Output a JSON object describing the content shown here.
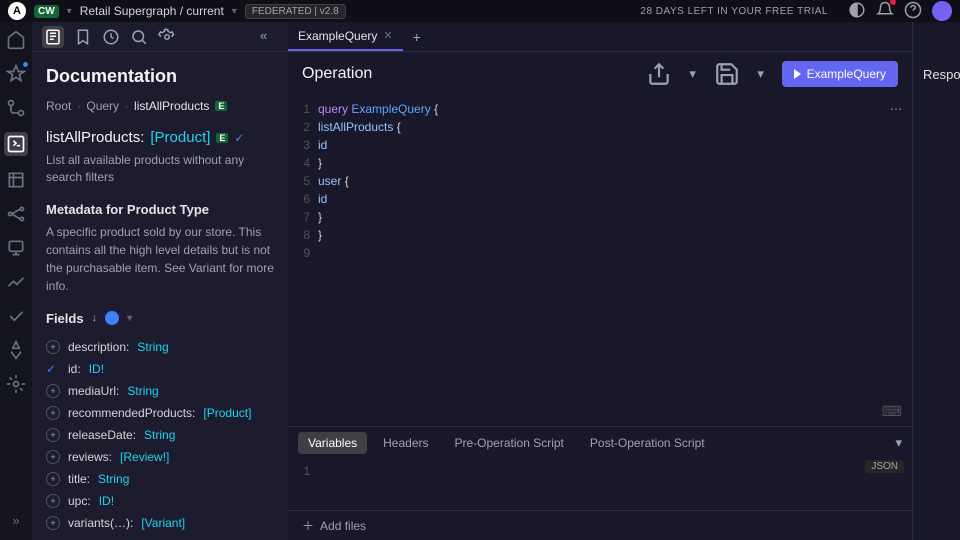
{
  "topbar": {
    "logo_letter": "A",
    "org_badge": "CW",
    "org_name": "Retail Supergraph / current",
    "federation_badge": "FEDERATED | v2.8",
    "trial_text": "28 DAYS LEFT IN YOUR FREE TRIAL"
  },
  "doc": {
    "title": "Documentation",
    "breadcrumb": [
      "Root",
      "Query",
      "listAllProducts"
    ],
    "entity_heading_name": "listAllProducts:",
    "entity_heading_type": "[Product]",
    "description": "List all available products without any search filters",
    "metadata_title": "Metadata for Product Type",
    "metadata_text": "A specific product sold by our store. This contains all the high level details but is not the purchasable item. See Variant for more info.",
    "fields_label": "Fields",
    "fields": [
      {
        "name": "description:",
        "type": "String",
        "checked": false
      },
      {
        "name": "id:",
        "type": "ID!",
        "checked": true
      },
      {
        "name": "mediaUrl:",
        "type": "String",
        "checked": false
      },
      {
        "name": "recommendedProducts:",
        "type": "[Product]",
        "checked": false
      },
      {
        "name": "releaseDate:",
        "type": "String",
        "checked": false
      },
      {
        "name": "reviews:",
        "type": "[Review!]",
        "checked": false
      },
      {
        "name": "title:",
        "type": "String",
        "checked": false
      },
      {
        "name": "upc:",
        "type": "ID!",
        "checked": false
      },
      {
        "name": "variants(…):",
        "type": "[Variant]",
        "checked": false
      }
    ]
  },
  "operation": {
    "tab_name": "ExampleQuery",
    "header": "Operation",
    "run_label": "ExampleQuery",
    "code_lines": [
      {
        "n": 1,
        "tokens": [
          {
            "t": "query ",
            "c": "kw"
          },
          {
            "t": "ExampleQuery ",
            "c": "ident"
          },
          {
            "t": "{",
            "c": "brace"
          }
        ]
      },
      {
        "n": 2,
        "tokens": [
          {
            "t": "  ",
            "c": ""
          },
          {
            "t": "listAllProducts ",
            "c": "field-tok"
          },
          {
            "t": "{",
            "c": "brace"
          }
        ]
      },
      {
        "n": 3,
        "tokens": [
          {
            "t": "    ",
            "c": ""
          },
          {
            "t": "id",
            "c": "field-tok"
          }
        ]
      },
      {
        "n": 4,
        "tokens": [
          {
            "t": "  ",
            "c": ""
          },
          {
            "t": "}",
            "c": "brace"
          }
        ]
      },
      {
        "n": 5,
        "tokens": [
          {
            "t": "  ",
            "c": ""
          },
          {
            "t": "user ",
            "c": "field-tok"
          },
          {
            "t": "{",
            "c": "brace"
          }
        ]
      },
      {
        "n": 6,
        "tokens": [
          {
            "t": "    ",
            "c": ""
          },
          {
            "t": "id",
            "c": "field-tok"
          }
        ]
      },
      {
        "n": 7,
        "tokens": [
          {
            "t": "  ",
            "c": ""
          },
          {
            "t": "}",
            "c": "brace"
          }
        ]
      },
      {
        "n": 8,
        "tokens": [
          {
            "t": "}",
            "c": "brace"
          }
        ]
      },
      {
        "n": 9,
        "tokens": []
      }
    ],
    "bottom_tabs": [
      "Variables",
      "Headers",
      "Pre-Operation Script",
      "Post-Operation Script"
    ],
    "json_badge": "JSON",
    "add_files": "Add files"
  },
  "response": {
    "header": "Response"
  }
}
